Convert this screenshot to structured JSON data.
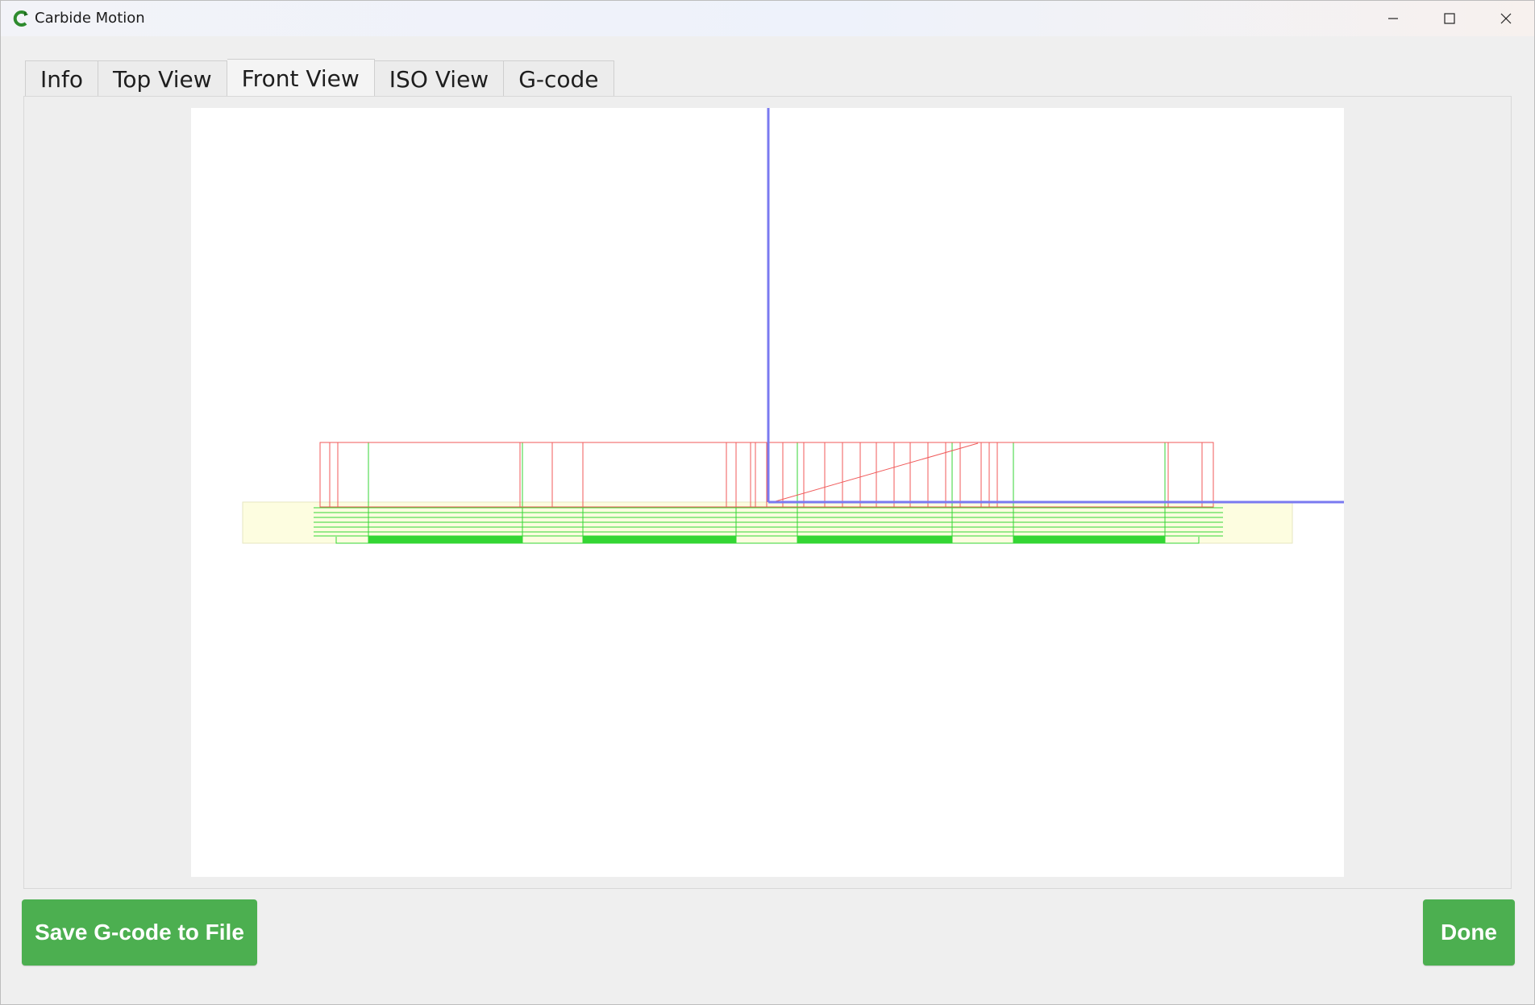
{
  "window": {
    "title": "Carbide Motion"
  },
  "tabs": [
    {
      "label": "Info",
      "active": false
    },
    {
      "label": "Top View",
      "active": false
    },
    {
      "label": "Front View",
      "active": true
    },
    {
      "label": "ISO View",
      "active": false
    },
    {
      "label": "G-code",
      "active": false
    }
  ],
  "buttons": {
    "save": "Save G-code to File",
    "done": "Done"
  },
  "colors": {
    "accent": "#4caf50",
    "axis": "#7a7af0",
    "rapid": "#f05a5a",
    "cut": "#34d634",
    "stock": "#fdfde0"
  },
  "icons": [
    "carbide-logo-icon",
    "minimize-icon",
    "maximize-icon",
    "close-icon"
  ]
}
